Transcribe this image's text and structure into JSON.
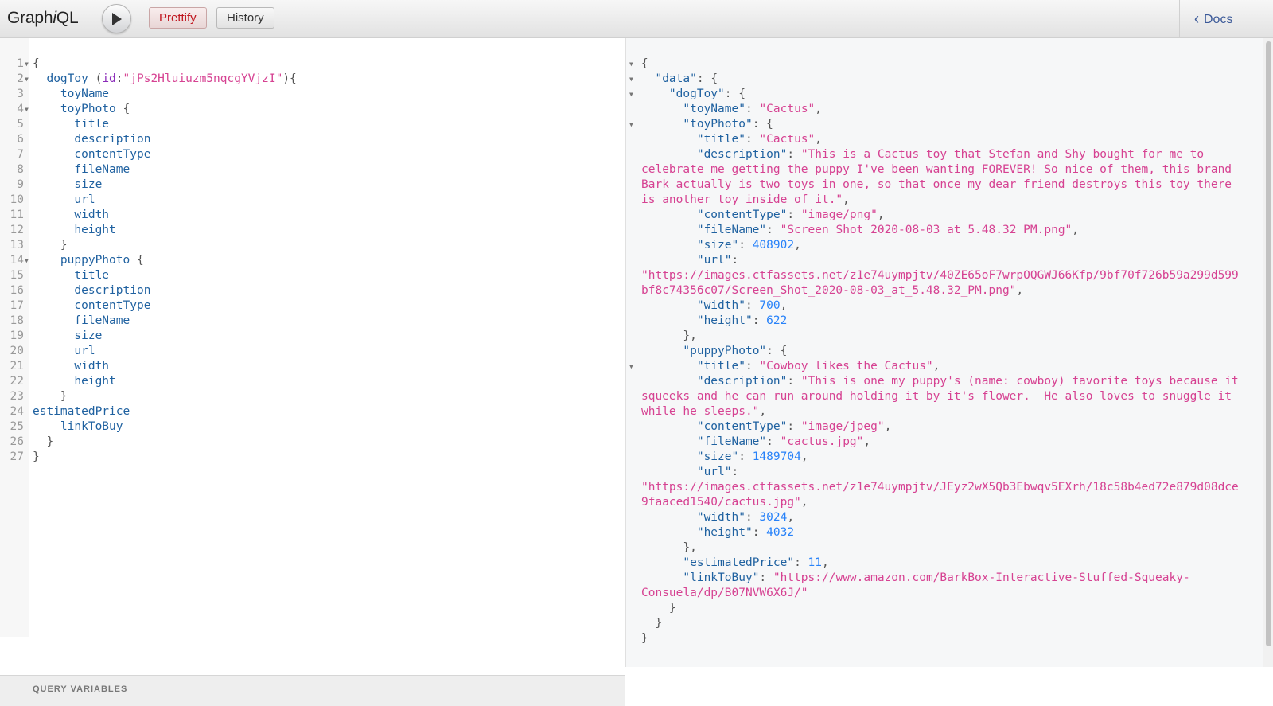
{
  "toolbar": {
    "logo_prefix": "Graph",
    "logo_italic": "i",
    "logo_suffix": "QL",
    "prettify_label": "Prettify",
    "history_label": "History",
    "docs_label": "Docs"
  },
  "query_editor": {
    "line_numbers": [
      "1",
      "2",
      "3",
      "4",
      "5",
      "6",
      "7",
      "8",
      "9",
      "10",
      "11",
      "12",
      "13",
      "14",
      "15",
      "16",
      "17",
      "18",
      "19",
      "20",
      "21",
      "22",
      "23",
      "24",
      "25",
      "26",
      "27"
    ],
    "folded_lines": [
      1,
      2,
      4,
      14
    ],
    "query_id": "jPs2Hluiuzm5nqcgYVjzI",
    "root_field": "dogToy",
    "arg_name": "id",
    "fields": {
      "toy_name": "toyName",
      "toy_photo": "toyPhoto",
      "puppy_photo": "puppyPhoto",
      "estimated_price": "estimatedPrice",
      "link_to_buy": "linkToBuy"
    },
    "photo_fields": [
      "title",
      "description",
      "contentType",
      "fileName",
      "size",
      "url",
      "width",
      "height"
    ]
  },
  "variables_panel": {
    "title": "QUERY VARIABLES"
  },
  "result": {
    "toyName": "\"Cactus\"",
    "toyPhoto": {
      "title": "\"Cactus\"",
      "description": "\"This is a Cactus toy that Stefan and Shy bought for me to celebrate me getting the puppy I've been wanting FOREVER! So nice of them, this brand Bark actually is two toys in one, so that once my dear friend destroys this toy there is another toy inside of it.\"",
      "contentType": "\"image/png\"",
      "fileName": "\"Screen Shot 2020-08-03 at 5.48.32 PM.png\"",
      "size": "408902",
      "url": "\"https://images.ctfassets.net/z1e74uympjtv/40ZE65oF7wrpOQGWJ66Kfp/9bf70f726b59a299d599bf8c74356c07/Screen_Shot_2020-08-03_at_5.48.32_PM.png\"",
      "width": "700",
      "height": "622"
    },
    "puppyPhoto": {
      "title": "\"Cowboy likes the Cactus\"",
      "description": "\"This is one my puppy's (name: cowboy) favorite toys because it squeeks and he can run around holding it by it's flower.  He also loves to snuggle it while he sleeps.\"",
      "contentType": "\"image/jpeg\"",
      "fileName": "\"cactus.jpg\"",
      "size": "1489704",
      "url": "\"https://images.ctfassets.net/z1e74uympjtv/JEyz2wX5Qb3Ebwqv5EXrh/18c58b4ed72e879d08dce9faaced1540/cactus.jpg\"",
      "width": "3024",
      "height": "4032"
    },
    "estimatedPrice": "11",
    "linkToBuy": "\"https://www.amazon.com/BarkBox-Interactive-Stuffed-Squeaky-Consuela/dp/B07NVW6X6J/\""
  },
  "colors": {
    "field": "#1f61a0",
    "string": "#d64292",
    "number": "#2882f9",
    "argument": "#8b2bb9",
    "prettify_text": "#c0151e",
    "docs_link": "#3b5998"
  }
}
